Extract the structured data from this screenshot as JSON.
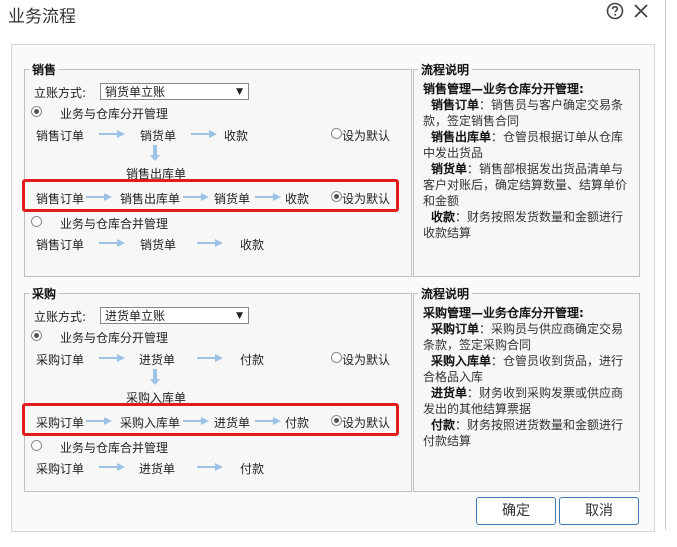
{
  "dialog": {
    "title": "业务流程",
    "help_icon": "help-circle-icon",
    "close_icon": "close-icon"
  },
  "sales": {
    "legend": "销售",
    "method_label": "立账方式:",
    "method_value": "销货单立账",
    "separate_option": "业务与仓库分开管理",
    "separate_selected": true,
    "merged_option": "业务与仓库合并管理",
    "flow_separate": [
      "销售订单",
      "销货单",
      "收款"
    ],
    "default_label": "设为默认",
    "branch_label": "销售出库单",
    "flow_highlight": [
      "销售订单",
      "销售出库单",
      "销货单",
      "收款"
    ],
    "highlight_default_label": "设为默认",
    "highlight_default_selected": true,
    "flow_merged": [
      "销售订单",
      "销货单",
      "收款"
    ],
    "desc": {
      "legend": "流程说明",
      "heading": "销售管理—业务仓库分开管理:",
      "items": [
        {
          "term": "销售订单",
          "text": "：销售员与客户确定交易条款，签定销售合同"
        },
        {
          "term": "销售出库单",
          "text": "：仓管员根据订单从仓库中发出货品"
        },
        {
          "term": "销货单",
          "text": "：销售部根据发出货品清单与客户对账后，确定结算数量、结算单价和金额"
        },
        {
          "term": "收款",
          "text": "：财务按照发货数量和金额进行收款结算"
        }
      ]
    }
  },
  "purchase": {
    "legend": "采购",
    "method_label": "立账方式:",
    "method_value": "进货单立账",
    "separate_option": "业务与仓库分开管理",
    "separate_selected": true,
    "merged_option": "业务与仓库合并管理",
    "flow_separate": [
      "采购订单",
      "进货单",
      "付款"
    ],
    "default_label": "设为默认",
    "branch_label": "采购入库单",
    "flow_highlight": [
      "采购订单",
      "采购入库单",
      "进货单",
      "付款"
    ],
    "highlight_default_label": "设为默认",
    "highlight_default_selected": true,
    "flow_merged": [
      "采购订单",
      "进货单",
      "付款"
    ],
    "desc": {
      "legend": "流程说明",
      "heading": "采购管理—业务仓库分开管理:",
      "items": [
        {
          "term": "采购订单",
          "text": "：采购员与供应商确定交易条款，签定采购合同"
        },
        {
          "term": "采购入库单",
          "text": "：仓管员收到货品，进行合格品入库"
        },
        {
          "term": "进货单",
          "text": "：财务收到采购发票或供应商发出的其他结算票据"
        },
        {
          "term": "付款",
          "text": "：财务按照进货数量和金额进行付款结算"
        }
      ]
    }
  },
  "buttons": {
    "ok": "确定",
    "cancel": "取消"
  },
  "colors": {
    "highlight": "#e31b1b",
    "arrow": "#9cc3e6",
    "button_border": "#3f79b5"
  }
}
